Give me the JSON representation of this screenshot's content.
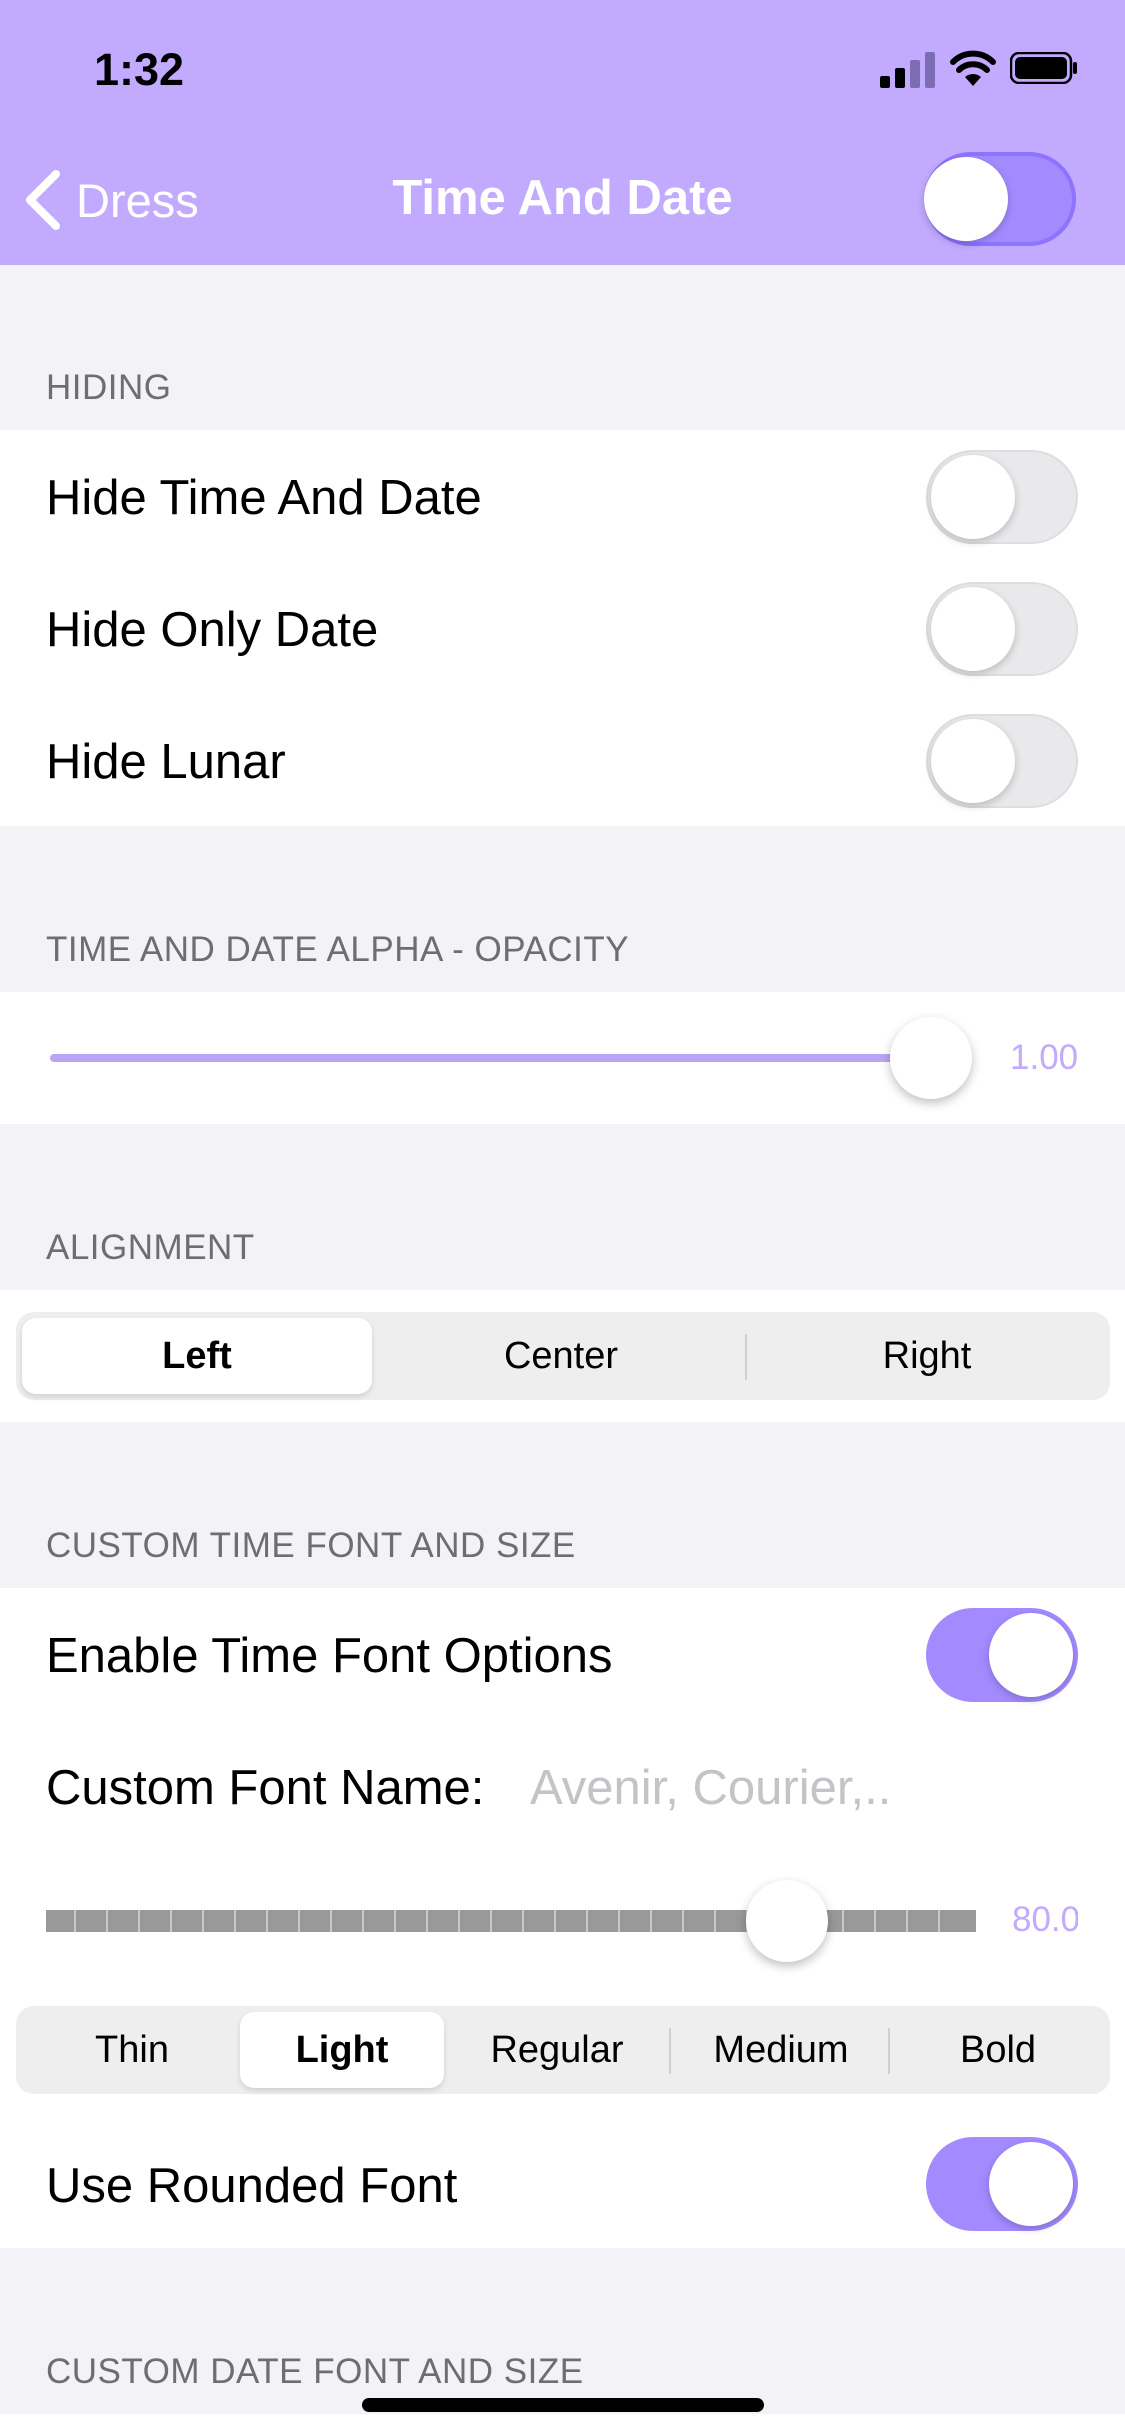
{
  "status_bar": {
    "time": "1:32"
  },
  "nav": {
    "back_label": "Dress",
    "title": "Time And Date",
    "enabled": true
  },
  "sections": {
    "hiding": {
      "header": "HIDING",
      "rows": [
        {
          "label": "Hide Time And Date",
          "on": false
        },
        {
          "label": "Hide Only Date",
          "on": false
        },
        {
          "label": "Hide Lunar",
          "on": false
        }
      ]
    },
    "opacity": {
      "header": "TIME AND DATE ALPHA - OPACITY",
      "value": 1.0,
      "value_label": "1.00"
    },
    "alignment": {
      "header": "ALIGNMENT",
      "options": [
        "Left",
        "Center",
        "Right"
      ],
      "selected": "Left"
    },
    "time_font": {
      "header": "CUSTOM TIME FONT AND SIZE",
      "enable_label": "Enable Time Font Options",
      "enable_on": true,
      "font_name_label": "Custom Font Name:",
      "font_name_placeholder": "Avenir, Courier,..",
      "size_value_label": "80.0",
      "weights": [
        "Thin",
        "Light",
        "Regular",
        "Medium",
        "Bold"
      ],
      "selected_weight": "Light",
      "rounded_label": "Use Rounded Font",
      "rounded_on": true
    },
    "date_font": {
      "header": "CUSTOM DATE FONT AND SIZE"
    }
  },
  "colors": {
    "accent": "#a38aff",
    "header_bg": "#c1aaff",
    "value_text": "#c1aaff"
  }
}
